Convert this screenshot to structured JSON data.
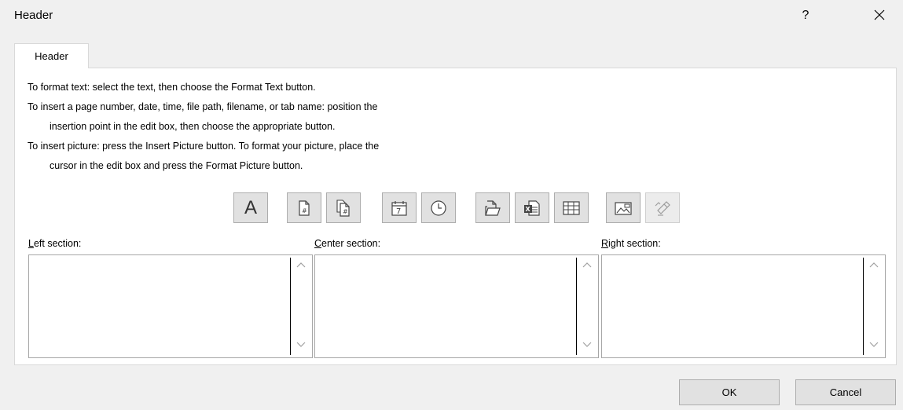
{
  "window": {
    "title": "Header",
    "help_label": "?",
    "close_icon": "close-icon"
  },
  "tabs": [
    {
      "label": "Header",
      "selected": true
    }
  ],
  "instructions": [
    "To format text:  select the text, then choose the Format Text button.",
    "To insert a page number, date, time, file path, filename, or tab name:  position the",
    "insertion point in the edit box, then choose the appropriate button.",
    "To insert picture: press the Insert Picture button.  To format your picture, place the",
    "cursor in the edit box and press the Format Picture button."
  ],
  "toolbar": [
    {
      "name": "format-text",
      "icon": "format-text-icon",
      "glyph": "A"
    },
    {
      "name": "insert-page-number",
      "icon": "page-number-icon"
    },
    {
      "name": "insert-number-of-pages",
      "icon": "number-of-pages-icon"
    },
    {
      "name": "insert-date",
      "icon": "calendar-icon",
      "glyph": "7"
    },
    {
      "name": "insert-time",
      "icon": "clock-icon"
    },
    {
      "name": "insert-file-path",
      "icon": "file-path-icon"
    },
    {
      "name": "insert-file-name",
      "icon": "file-name-icon"
    },
    {
      "name": "insert-sheet-name",
      "icon": "sheet-name-icon"
    },
    {
      "name": "insert-picture",
      "icon": "picture-icon"
    },
    {
      "name": "format-picture",
      "icon": "format-picture-icon",
      "disabled": true
    }
  ],
  "sections": {
    "left": {
      "mnemonic": "L",
      "rest": "eft section:",
      "value": ""
    },
    "center": {
      "mnemonic": "C",
      "rest": "enter section:",
      "value": ""
    },
    "right": {
      "mnemonic": "R",
      "rest": "ight section:",
      "value": ""
    }
  },
  "buttons": {
    "ok": "OK",
    "cancel": "Cancel"
  }
}
